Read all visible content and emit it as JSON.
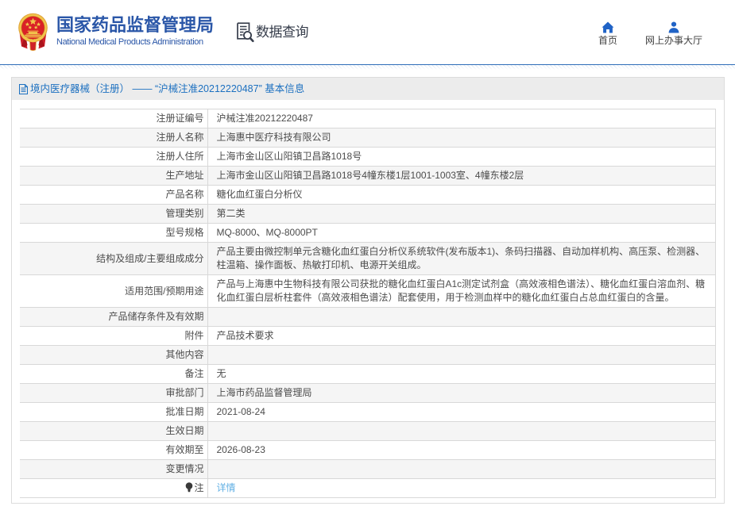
{
  "header": {
    "brand_cn": "国家药品监督管理局",
    "brand_en": "National Medical Products Administration",
    "section_label": "数据查询",
    "nav": [
      {
        "label": "首页",
        "icon": "home-icon"
      },
      {
        "label": "网上办事大厅",
        "icon": "user-icon"
      }
    ]
  },
  "panel": {
    "title": "境内医疗器械（注册） —— “沪械注准20212220487” 基本信息"
  },
  "table": {
    "rows": [
      {
        "label": "注册证编号",
        "value": "沪械注准20212220487"
      },
      {
        "label": "注册人名称",
        "value": "上海惠中医疗科技有限公司"
      },
      {
        "label": "注册人住所",
        "value": "上海市金山区山阳镇卫昌路1018号"
      },
      {
        "label": "生产地址",
        "value": "上海市金山区山阳镇卫昌路1018号4幢东楼1层1001-1003室、4幢东楼2层"
      },
      {
        "label": "产品名称",
        "value": "糖化血红蛋白分析仪"
      },
      {
        "label": "管理类别",
        "value": "第二类"
      },
      {
        "label": "型号规格",
        "value": "MQ-8000、MQ-8000PT"
      },
      {
        "label": "结构及组成/主要组成成分",
        "value": "产品主要由微控制单元含糖化血红蛋白分析仪系统软件(发布版本1)、条码扫描器、自动加样机构、高压泵、检测器、柱温箱、操作面板、热敏打印机、电源开关组成。"
      },
      {
        "label": "适用范围/预期用途",
        "value": "产品与上海惠中生物科技有限公司获批的糖化血红蛋白A1c测定试剂盒（高效液相色谱法）、糖化血红蛋白溶血剂、糖化血红蛋白层析柱套件（高效液相色谱法）配套使用，用于检测血样中的糖化血红蛋白占总血红蛋白的含量。"
      },
      {
        "label": "产品储存条件及有效期",
        "value": ""
      },
      {
        "label": "附件",
        "value": "产品技术要求"
      },
      {
        "label": "其他内容",
        "value": ""
      },
      {
        "label": "备注",
        "value": "无"
      },
      {
        "label": "审批部门",
        "value": "上海市药品监督管理局"
      },
      {
        "label": "批准日期",
        "value": "2021-08-24"
      },
      {
        "label": "生效日期",
        "value": ""
      },
      {
        "label": "有效期至",
        "value": "2026-08-23"
      },
      {
        "label": "变更情况",
        "value": ""
      },
      {
        "label": "注",
        "label_icon": "bulb-icon",
        "value": "详情",
        "value_link": true
      }
    ]
  }
}
